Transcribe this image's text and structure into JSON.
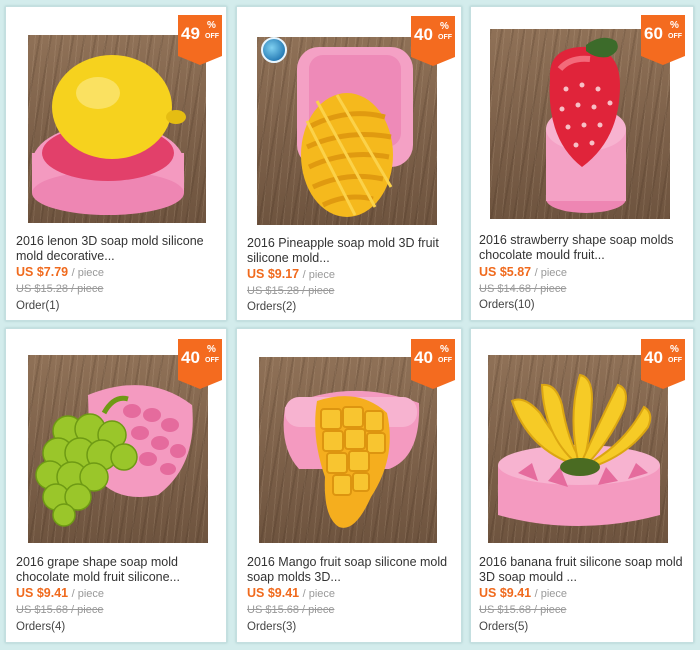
{
  "colors": {
    "background": "#d3ecec",
    "accent": "#f46b1f",
    "price": "#f06a1d",
    "muted": "#999999"
  },
  "products": [
    {
      "title": "2016 lenon 3D soap mold silicone mold decorative...",
      "price": "US $7.79",
      "unit": "/ piece",
      "original_price": "US $15.28 / piece",
      "orders": "Order(1)",
      "discount": "49",
      "percent": "%",
      "off": "OFF",
      "image": "lemon-soap-in-pink-mold"
    },
    {
      "title": "2016 Pineapple soap mold 3D fruit silicone mold...",
      "price": "US $9.17",
      "unit": "/ piece",
      "original_price": "US $15.28 / piece",
      "orders": "Orders(2)",
      "discount": "40",
      "percent": "%",
      "off": "OFF",
      "image": "pineapple-soap-in-pink-mold"
    },
    {
      "title": "2016 strawberry shape soap molds chocolate mould fruit...",
      "price": "US $5.87",
      "unit": "/ piece",
      "original_price": "US $14.68 / piece",
      "orders": "Orders(10)",
      "discount": "60",
      "percent": "%",
      "off": "OFF",
      "image": "strawberry-soap-in-pink-mold"
    },
    {
      "title": "2016 grape shape soap mold chocolate mold fruit silicone...",
      "price": "US $9.41",
      "unit": "/ piece",
      "original_price": "US $15.68 / piece",
      "orders": "Orders(4)",
      "discount": "40",
      "percent": "%",
      "off": "OFF",
      "image": "grape-soap-beside-pink-mold"
    },
    {
      "title": "2016 Mango fruit soap silicone mold soap molds 3D...",
      "price": "US $9.41",
      "unit": "/ piece",
      "original_price": "US $15.68 / piece",
      "orders": "Orders(3)",
      "discount": "40",
      "percent": "%",
      "off": "OFF",
      "image": "mango-soap-on-pink-mold"
    },
    {
      "title": "2016 banana fruit silicone soap mold 3D soap mould ...",
      "price": "US $9.41",
      "unit": "/ piece",
      "original_price": "US $15.68 / piece",
      "orders": "Orders(5)",
      "discount": "40",
      "percent": "%",
      "off": "OFF",
      "image": "banana-soap-in-pink-mold"
    }
  ]
}
